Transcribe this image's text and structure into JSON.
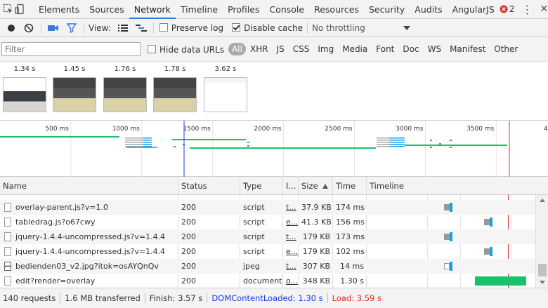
{
  "tabs": [
    "Elements",
    "Sources",
    "Network",
    "Timeline",
    "Profiles",
    "Console",
    "Resources",
    "Security",
    "Audits",
    "AngularJS"
  ],
  "active_tab": "Network",
  "error_count": "2",
  "toolbar": {
    "view_label": "View:",
    "preserve_log": "Preserve log",
    "disable_cache": "Disable cache",
    "throttling": "No throttling"
  },
  "filter": {
    "placeholder": "Filter",
    "hide_data_urls": "Hide data URLs",
    "types": [
      "All",
      "XHR",
      "JS",
      "CSS",
      "Img",
      "Media",
      "Font",
      "Doc",
      "WS",
      "Manifest",
      "Other"
    ]
  },
  "filmstrip": [
    "1.34 s",
    "1.45 s",
    "1.76 s",
    "1.78 s",
    "3.62 s"
  ],
  "overview_ticks": [
    "500 ms",
    "1000 ms",
    "1500 ms",
    "2000 ms",
    "2500 ms",
    "3000 ms",
    "3500 ms",
    "4"
  ],
  "columns": {
    "name": "Name",
    "status": "Status",
    "type": "Type",
    "initiator": "I...",
    "size": "Size",
    "time": "Time",
    "timeline": "Timeline"
  },
  "rows": [
    {
      "name": "overlay-parent.js?v=1.0",
      "status": "200",
      "type": "script",
      "initiator": "t...",
      "size": "37.9 KB",
      "time": "174 ms",
      "icon": "file-icon",
      "wait": 0.01,
      "recv": 0.005,
      "start": 0.49
    },
    {
      "name": "tabledrag.js?o67cwy",
      "status": "200",
      "type": "script",
      "initiator": "e...",
      "size": "41.3 KB",
      "time": "156 ms",
      "icon": "file-icon",
      "wait": 0.01,
      "recv": 0.005,
      "start": 0.73
    },
    {
      "name": "jquery-1.4.4-uncompressed.js?v=1.4.4",
      "status": "200",
      "type": "script",
      "initiator": "t...",
      "size": "179 KB",
      "time": "173 ms",
      "icon": "file-icon",
      "wait": 0.01,
      "recv": 0.005,
      "start": 0.49
    },
    {
      "name": "jquery-1.4.4-uncompressed.js?v=1.4.4",
      "status": "200",
      "type": "script",
      "initiator": "e...",
      "size": "179 KB",
      "time": "102 ms",
      "icon": "file-icon",
      "wait": 0.005,
      "recv": 0.005,
      "start": 0.73
    },
    {
      "name": "bedienden03_v2.jpg?itok=osAYQnQv",
      "status": "200",
      "type": "jpeg",
      "initiator": "t...",
      "size": "307 KB",
      "time": "14 ms",
      "icon": "image-icon",
      "wait": 0.015,
      "recv": 0.005,
      "start": 0.49
    },
    {
      "name": "edit?render=overlay",
      "status": "200",
      "type": "document",
      "initiator": "o...",
      "size": "348 KB",
      "time": "1.30 s",
      "icon": "file-icon",
      "wait": 0.3,
      "recv": 0.005,
      "start": 0.64
    }
  ],
  "status": {
    "requests": "140 requests",
    "transferred": "1.6 MB transferred",
    "finish": "Finish: 3.57 s",
    "dom": "DOMContentLoaded: 1.30 s",
    "load": "Load: 3.59 s"
  },
  "colors": {
    "dom_blue": "#1a3cf0",
    "load_red": "#e0302b",
    "wait_green": "#17c26b",
    "recv_blue": "#1aa0e0",
    "queue_gray": "#999999"
  }
}
